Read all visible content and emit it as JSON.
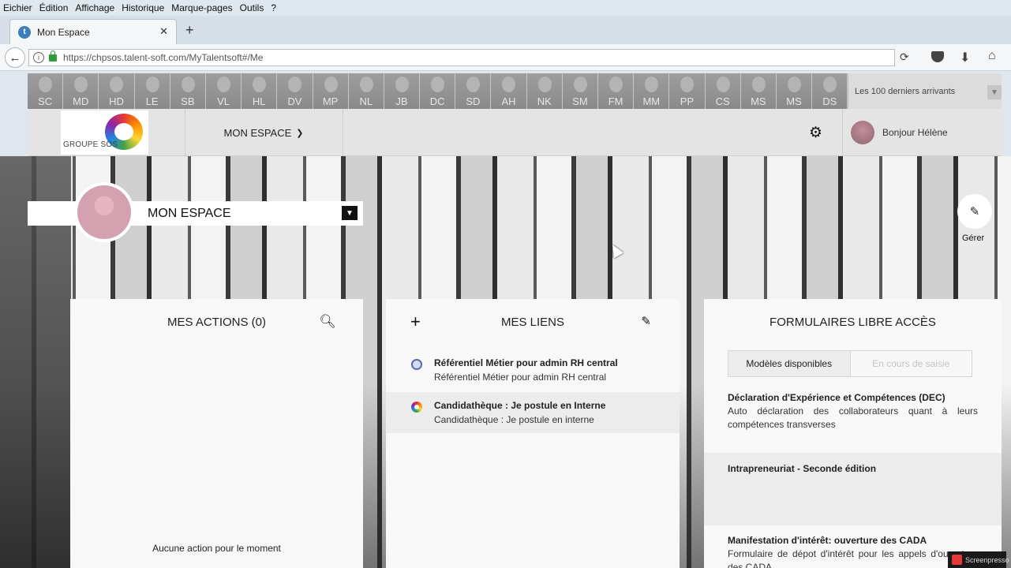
{
  "browser": {
    "menu": [
      "Eichier",
      "Édition",
      "Affichage",
      "Historique",
      "Marque-pages",
      "Outils",
      "?"
    ],
    "tab_title": "Mon Espace",
    "url": "https://chpsos.talent-soft.com/MyTalentsoft#/Me"
  },
  "app": {
    "avatars": [
      "SC",
      "MD",
      "HD",
      "LE",
      "SB",
      "VL",
      "HL",
      "DV",
      "MP",
      "NL",
      "JB",
      "DC",
      "SD",
      "AH",
      "NK",
      "SM",
      "FM",
      "MM",
      "PP",
      "CS",
      "MS",
      "MS",
      "DS"
    ],
    "arrivals_label": "Les 100 derniers arrivants",
    "logo_text": "GROUPE SOS",
    "nav_menu": "MON ESPACE",
    "greeting": "Bonjour Hélène",
    "espace_title": "MON ESPACE",
    "gerer_label": "Gérer"
  },
  "actions_panel": {
    "title": "MES ACTIONS (0)",
    "empty": "Aucune action pour le moment"
  },
  "liens_panel": {
    "title": "MES LIENS",
    "links": [
      {
        "icon": "globe-icon",
        "title": "Référentiel Métier pour admin RH central",
        "subtitle": "Référentiel Métier pour admin RH central"
      },
      {
        "icon": "talentsoft-ring-icon",
        "title": "Candidathèque : Je postule en Interne",
        "subtitle": "Candidathèque : Je postule en interne"
      }
    ]
  },
  "forms_panel": {
    "title": "FORMULAIRES LIBRE ACCÈS",
    "tab_active": "Modèles disponibles",
    "tab_inactive": "En cours de saisie",
    "items": [
      {
        "title": "Déclaration d'Expérience et Compétences (DEC)",
        "desc": "Auto déclaration des collaborateurs quant à leurs compétences transverses"
      },
      {
        "title": "Intrapreneuriat - Seconde édition",
        "desc": ""
      },
      {
        "title": "Manifestation d'intérêt: ouverture des CADA",
        "desc": "Formulaire de dépot d'intérêt pour les appels d'ouverture des CADA"
      }
    ]
  },
  "watermark": "Screenpresso"
}
